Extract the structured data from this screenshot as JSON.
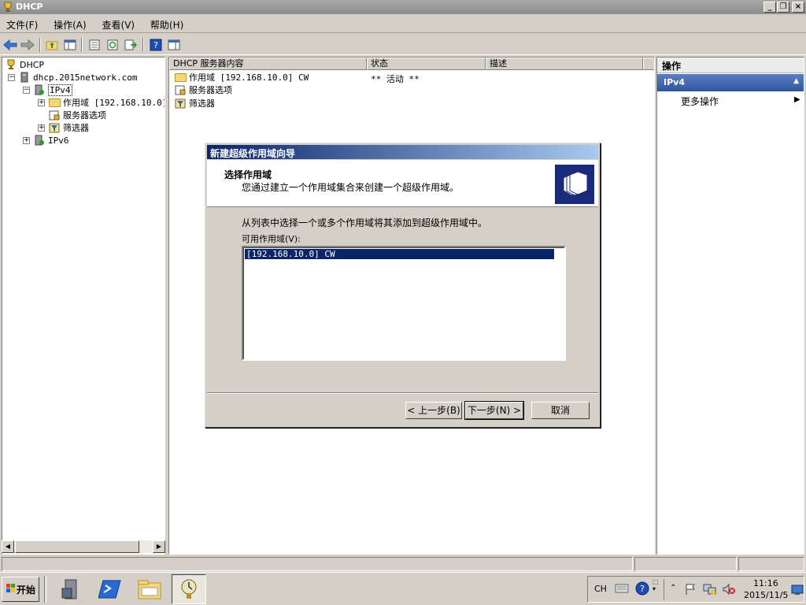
{
  "window": {
    "title": "DHCP",
    "icon": "dhcp-trophy-icon",
    "controls": [
      "_",
      "❐",
      "×"
    ]
  },
  "menu": {
    "items": [
      "文件(F)",
      "操作(A)",
      "查看(V)",
      "帮助(H)"
    ]
  },
  "toolbar": {
    "icons": [
      "back-arrow-icon",
      "forward-arrow-icon",
      "up-folder-icon",
      "show-tree-icon",
      "properties-icon",
      "refresh-icon",
      "export-list-icon",
      "help-icon",
      "show-action-pane-icon"
    ]
  },
  "tree": {
    "root": "DHCP",
    "server": "dhcp.2015network.com",
    "ipv4": "IPv4",
    "scope": "作用域 [192.168.10.0] CW",
    "server_options": "服务器选项",
    "filters": "筛选器",
    "ipv6": "IPv6"
  },
  "content": {
    "columns": [
      "DHCP 服务器内容",
      "状态",
      "描述"
    ],
    "rows": [
      {
        "name": "作用域 [192.168.10.0] CW",
        "status": "** 活动 **",
        "desc": ""
      },
      {
        "name": "服务器选项",
        "status": "",
        "desc": ""
      },
      {
        "name": "筛选器",
        "status": "",
        "desc": ""
      }
    ]
  },
  "actions": {
    "header": "操作",
    "section": "IPv4",
    "items": [
      "更多操作"
    ]
  },
  "dialog": {
    "title": "新建超级作用域向导",
    "heading": "选择作用域",
    "subheading": "您通过建立一个作用域集合来创建一个超级作用域。",
    "instruction": "从列表中选择一个或多个作用域将其添加到超级作用域中。",
    "list_label": "可用作用域(V):",
    "list_items": [
      "[192.168.10.0] CW"
    ],
    "buttons": {
      "back": "< 上一步(B)",
      "next": "下一步(N) >",
      "cancel": "取消"
    }
  },
  "taskbar": {
    "start": "开始",
    "apps": [
      "server-manager-icon",
      "powershell-icon",
      "explorer-icon",
      "dhcp-icon"
    ],
    "lang": "CH",
    "time": "11:16",
    "date": "2015/11/5"
  },
  "colors": {
    "dialog_title_start": "#0a246a",
    "dialog_title_end": "#a6caf0",
    "action_section": "#2f55a0",
    "selection": "#0a246a"
  }
}
